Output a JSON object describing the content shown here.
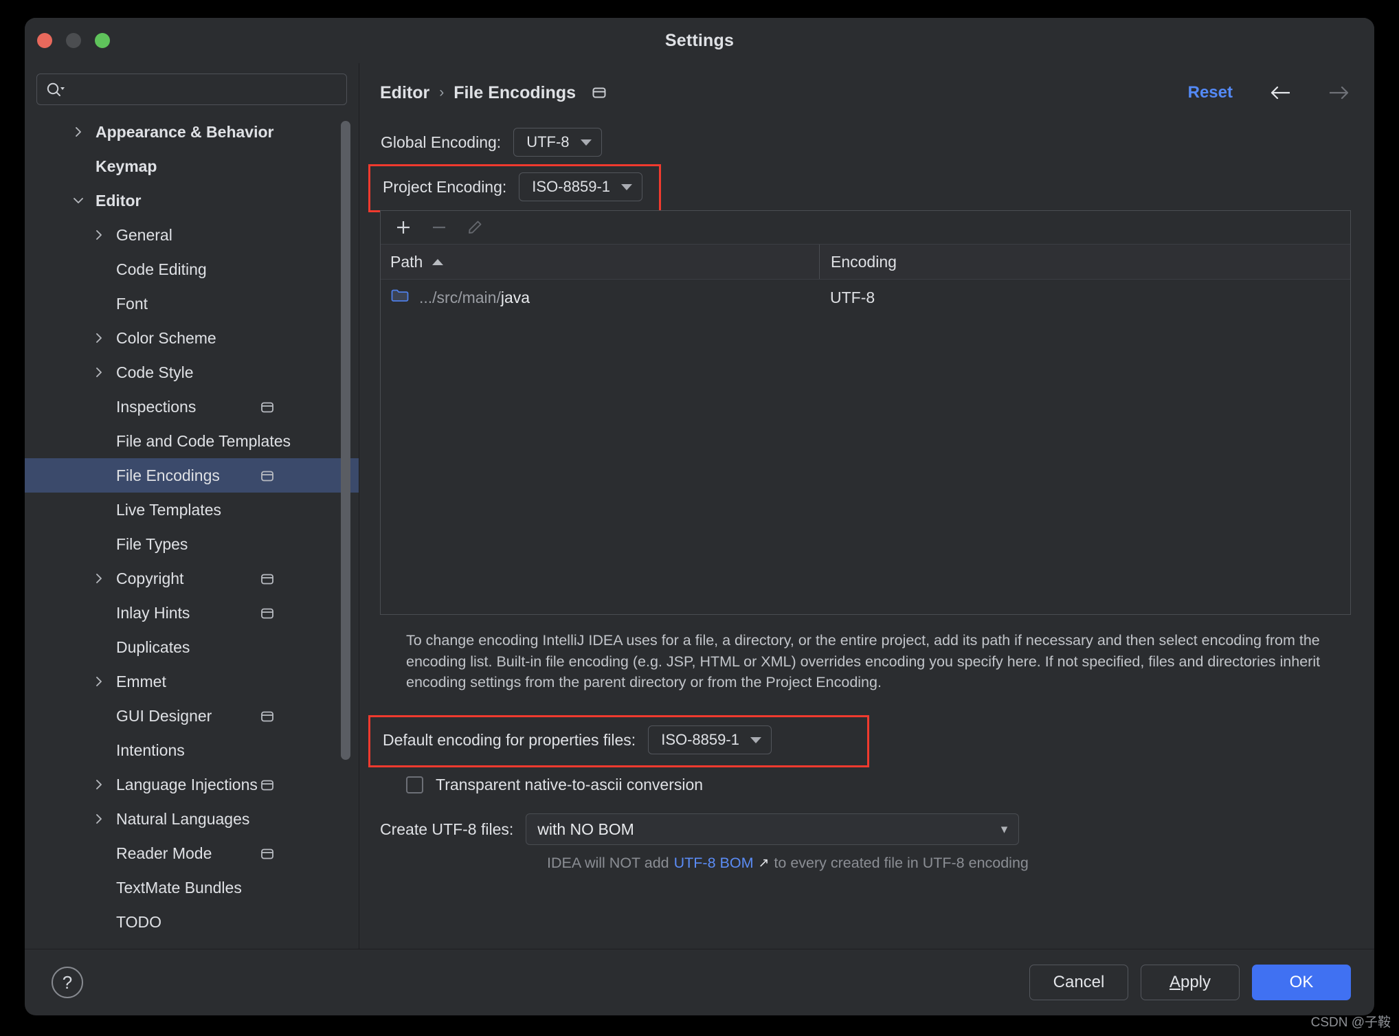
{
  "window": {
    "title": "Settings",
    "traffic_lights": [
      "close-button",
      "minimize-button",
      "zoom-button"
    ]
  },
  "sidebar": {
    "search": {
      "value": "",
      "placeholder": "",
      "icon": "search-icon"
    },
    "items": [
      {
        "label": "Appearance & Behavior",
        "level": 0,
        "twisty": "chevron-right",
        "bold": true,
        "badge": false,
        "selected": false
      },
      {
        "label": "Keymap",
        "level": 0,
        "twisty": "",
        "bold": true,
        "badge": false,
        "selected": false
      },
      {
        "label": "Editor",
        "level": 0,
        "twisty": "chevron-down",
        "bold": true,
        "badge": false,
        "selected": false
      },
      {
        "label": "General",
        "level": 1,
        "twisty": "chevron-right",
        "bold": false,
        "badge": false,
        "selected": false
      },
      {
        "label": "Code Editing",
        "level": 1,
        "twisty": "",
        "bold": false,
        "badge": false,
        "selected": false
      },
      {
        "label": "Font",
        "level": 1,
        "twisty": "",
        "bold": false,
        "badge": false,
        "selected": false
      },
      {
        "label": "Color Scheme",
        "level": 1,
        "twisty": "chevron-right",
        "bold": false,
        "badge": false,
        "selected": false
      },
      {
        "label": "Code Style",
        "level": 1,
        "twisty": "chevron-right",
        "bold": false,
        "badge": false,
        "selected": false
      },
      {
        "label": "Inspections",
        "level": 1,
        "twisty": "",
        "bold": false,
        "badge": true,
        "selected": false
      },
      {
        "label": "File and Code Templates",
        "level": 1,
        "twisty": "",
        "bold": false,
        "badge": false,
        "selected": false
      },
      {
        "label": "File Encodings",
        "level": 1,
        "twisty": "",
        "bold": false,
        "badge": true,
        "selected": true
      },
      {
        "label": "Live Templates",
        "level": 1,
        "twisty": "",
        "bold": false,
        "badge": false,
        "selected": false
      },
      {
        "label": "File Types",
        "level": 1,
        "twisty": "",
        "bold": false,
        "badge": false,
        "selected": false
      },
      {
        "label": "Copyright",
        "level": 1,
        "twisty": "chevron-right",
        "bold": false,
        "badge": true,
        "selected": false
      },
      {
        "label": "Inlay Hints",
        "level": 1,
        "twisty": "",
        "bold": false,
        "badge": true,
        "selected": false
      },
      {
        "label": "Duplicates",
        "level": 1,
        "twisty": "",
        "bold": false,
        "badge": false,
        "selected": false
      },
      {
        "label": "Emmet",
        "level": 1,
        "twisty": "chevron-right",
        "bold": false,
        "badge": false,
        "selected": false
      },
      {
        "label": "GUI Designer",
        "level": 1,
        "twisty": "",
        "bold": false,
        "badge": true,
        "selected": false
      },
      {
        "label": "Intentions",
        "level": 1,
        "twisty": "",
        "bold": false,
        "badge": false,
        "selected": false
      },
      {
        "label": "Language Injections",
        "level": 1,
        "twisty": "chevron-right",
        "bold": false,
        "badge": true,
        "selected": false
      },
      {
        "label": "Natural Languages",
        "level": 1,
        "twisty": "chevron-right",
        "bold": false,
        "badge": false,
        "selected": false
      },
      {
        "label": "Reader Mode",
        "level": 1,
        "twisty": "",
        "bold": false,
        "badge": true,
        "selected": false
      },
      {
        "label": "TextMate Bundles",
        "level": 1,
        "twisty": "",
        "bold": false,
        "badge": false,
        "selected": false
      },
      {
        "label": "TODO",
        "level": 1,
        "twisty": "",
        "bold": false,
        "badge": false,
        "selected": false
      }
    ]
  },
  "header": {
    "breadcrumb": [
      "Editor",
      "File Encodings"
    ],
    "separator": "›",
    "badge_icon": "project-scope-icon",
    "reset_label": "Reset",
    "back_icon": "arrow-left-icon",
    "forward_icon": "arrow-right-icon"
  },
  "main": {
    "global_encoding": {
      "label": "Global Encoding:",
      "value": "UTF-8"
    },
    "project_encoding": {
      "label": "Project Encoding:",
      "value": "ISO-8859-1"
    },
    "toolbar": {
      "add_icon": "plus-icon",
      "remove_icon": "minus-icon",
      "edit_icon": "pencil-icon"
    },
    "table": {
      "columns": [
        "Path",
        "Encoding"
      ],
      "sort_indicator": "chevron-up-icon",
      "rows": [
        {
          "icon": "folder-icon",
          "path_prefix": ".../src/main/",
          "path_name": "java",
          "encoding": "UTF-8"
        }
      ]
    },
    "description": "To change encoding IntelliJ IDEA uses for a file, a directory, or the entire project, add its path if necessary and then select encoding from the encoding list. Built-in file encoding (e.g. JSP, HTML or XML) overrides encoding you specify here. If not specified, files and directories inherit encoding settings from the parent directory or from the Project Encoding.",
    "properties_encoding": {
      "label": "Default encoding for properties files:",
      "value": "ISO-8859-1"
    },
    "transparent_checkbox": {
      "label": "Transparent native-to-ascii conversion",
      "checked": false
    },
    "create_utf8": {
      "label": "Create UTF-8 files:",
      "value": "with NO BOM"
    },
    "bom_hint": {
      "before": "IDEA will NOT add",
      "link": "UTF-8 BOM",
      "link_icon": "external-link-icon",
      "after": "to every created file in UTF-8 encoding"
    }
  },
  "footer": {
    "help_icon": "question-mark-icon",
    "cancel_label": "Cancel",
    "apply_label": "Apply",
    "apply_mnemonic": "A",
    "apply_rest": "pply",
    "ok_label": "OK"
  },
  "watermark": "CSDN @子鞍",
  "colors": {
    "window_bg": "#2b2d30",
    "selection": "#3b4a6b",
    "accent": "#4071f2",
    "link": "#548af7",
    "annotation": "#f03a2e"
  }
}
